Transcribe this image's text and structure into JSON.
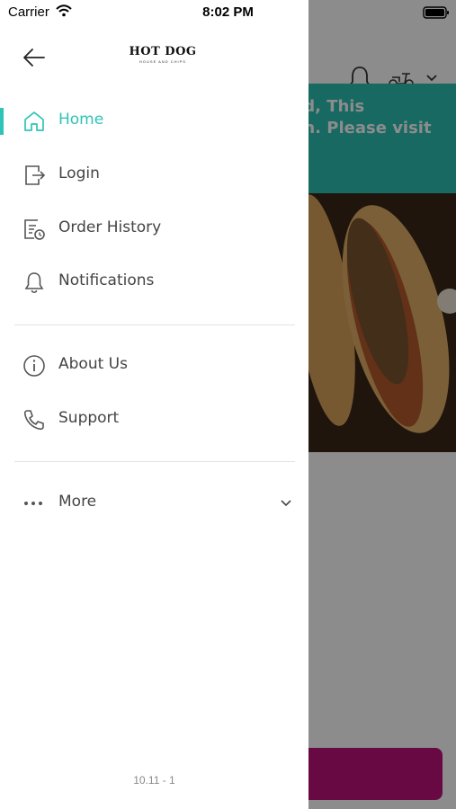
{
  "status_bar": {
    "carrier": "Carrier",
    "time": "8:02 PM"
  },
  "drawer": {
    "logo": {
      "main": "HOT DOG",
      "sub": "HOUSE AND CHIPS"
    },
    "menu_primary": [
      {
        "label": "Home",
        "icon": "home-icon",
        "active": true
      },
      {
        "label": "Login",
        "icon": "login-icon",
        "active": false
      },
      {
        "label": "Order History",
        "icon": "order-history-icon",
        "active": false
      },
      {
        "label": "Notifications",
        "icon": "bell-icon",
        "active": false
      }
    ],
    "menu_secondary": [
      {
        "label": "About Us",
        "icon": "info-icon"
      },
      {
        "label": "Support",
        "icon": "phone-icon"
      }
    ],
    "more": {
      "label": "More",
      "icon": "ellipsis-icon"
    },
    "version": "10.11 - 1",
    "accent_color": "#2ec4b6"
  },
  "background": {
    "banner_lines": [
      "ed, This",
      "on. Please visit",
      "/"
    ],
    "banner_color": "#2bbfb3",
    "bottom_button_color": "#c0127a"
  }
}
